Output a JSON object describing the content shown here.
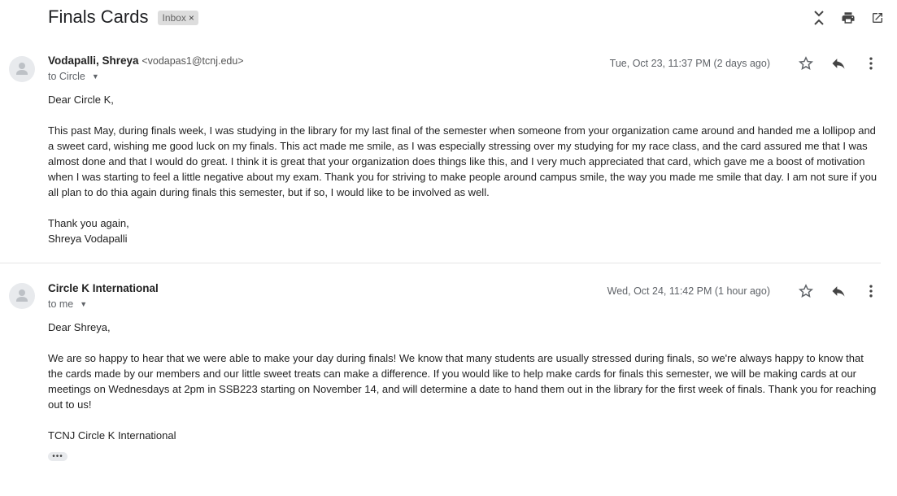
{
  "subject": "Finals Cards",
  "label": {
    "text": "Inbox",
    "remove": "×"
  },
  "icons": {
    "collapse": "collapse-all-icon",
    "print": "print-icon",
    "popout": "open-in-new-window-icon",
    "star": "star-icon",
    "reply": "reply-icon",
    "more": "more-vert-icon",
    "avatar": "person-avatar-icon"
  },
  "messages": [
    {
      "sender_name": "Vodapalli, Shreya",
      "sender_email": "<vodapas1@tcnj.edu>",
      "recipient": "to Circle",
      "date": "Tue, Oct 23, 11:37 PM (2 days ago)",
      "greeting": "Dear Circle K,",
      "paragraph": "This past May, during finals week, I was studying in the library for my last final of the semester when someone from your organization came around and handed me a lollipop and a sweet card, wishing me good luck on my finals. This act made me smile, as I was especially stressing over my studying for my race class, and the card assured me that I was almost done and that I would do great. I think it is great that your organization does things like this, and I very much appreciated that card, which gave me a boost of motivation when I was starting to feel a little negative about my exam. Thank you for striving to make people around campus smile, the way you made me smile that day. I am not sure if you all plan to do thia again during finals this semester, but if so, I would like to be involved as well.",
      "closing_line1": "Thank you again,",
      "closing_line2": "Shreya Vodapalli"
    },
    {
      "sender_name": "Circle K International",
      "sender_email": "",
      "recipient": "to me",
      "date": "Wed, Oct 24, 11:42 PM (1 hour ago)",
      "greeting": "Dear Shreya,",
      "paragraph": "We are so happy to hear that we were able to make your day during finals! We know that many students are usually stressed during finals, so we're always happy to know that the cards made by our members and our little sweet treats can make a difference. If you would like to help make cards for finals this semester, we will be making cards at our meetings on Wednesdays at 2pm in SSB223 starting on November 14, and will determine a date to hand them out in the library for the first week of finals. Thank you for reaching out to us!",
      "signature": "TCNJ Circle K International",
      "more_label": "•••"
    }
  ]
}
